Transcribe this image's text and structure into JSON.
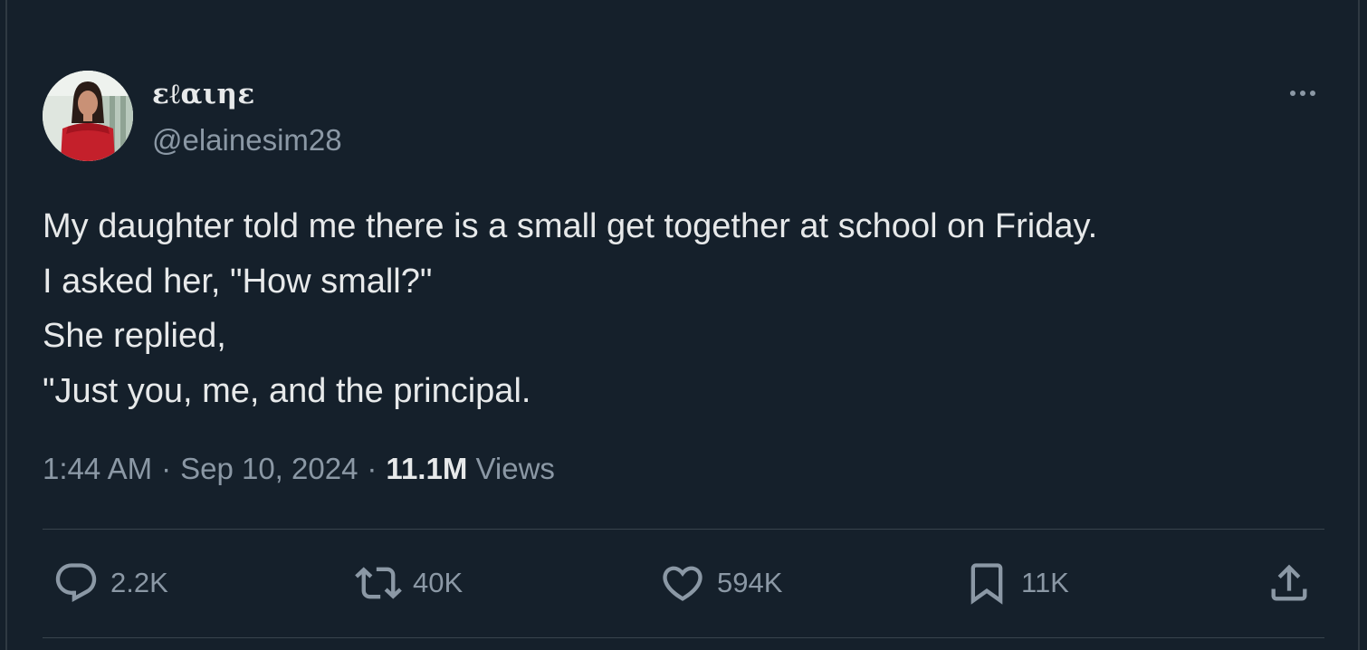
{
  "author": {
    "display_name": "εℓαιηε",
    "handle": "@elainesim28"
  },
  "tweet": {
    "lines": [
      "My daughter told me there is a small get together at school on Friday.",
      "I asked her, \"How small?\"",
      "She replied,",
      "\"Just you, me, and the principal."
    ],
    "time": "1:44 AM",
    "date": "Sep 10, 2024",
    "views_count": "11.1M",
    "views_label": "Views",
    "separator": "·"
  },
  "actions": {
    "reply": {
      "icon": "reply-icon",
      "count": "2.2K"
    },
    "retweet": {
      "icon": "retweet-icon",
      "count": "40K"
    },
    "like": {
      "icon": "heart-icon",
      "count": "594K"
    },
    "bookmark": {
      "icon": "bookmark-icon",
      "count": "11K"
    },
    "share": {
      "icon": "share-icon"
    }
  },
  "colors": {
    "background": "#15202b",
    "text_primary": "#e7e9ea",
    "text_secondary": "#8b98a5",
    "divider": "#38444d"
  }
}
